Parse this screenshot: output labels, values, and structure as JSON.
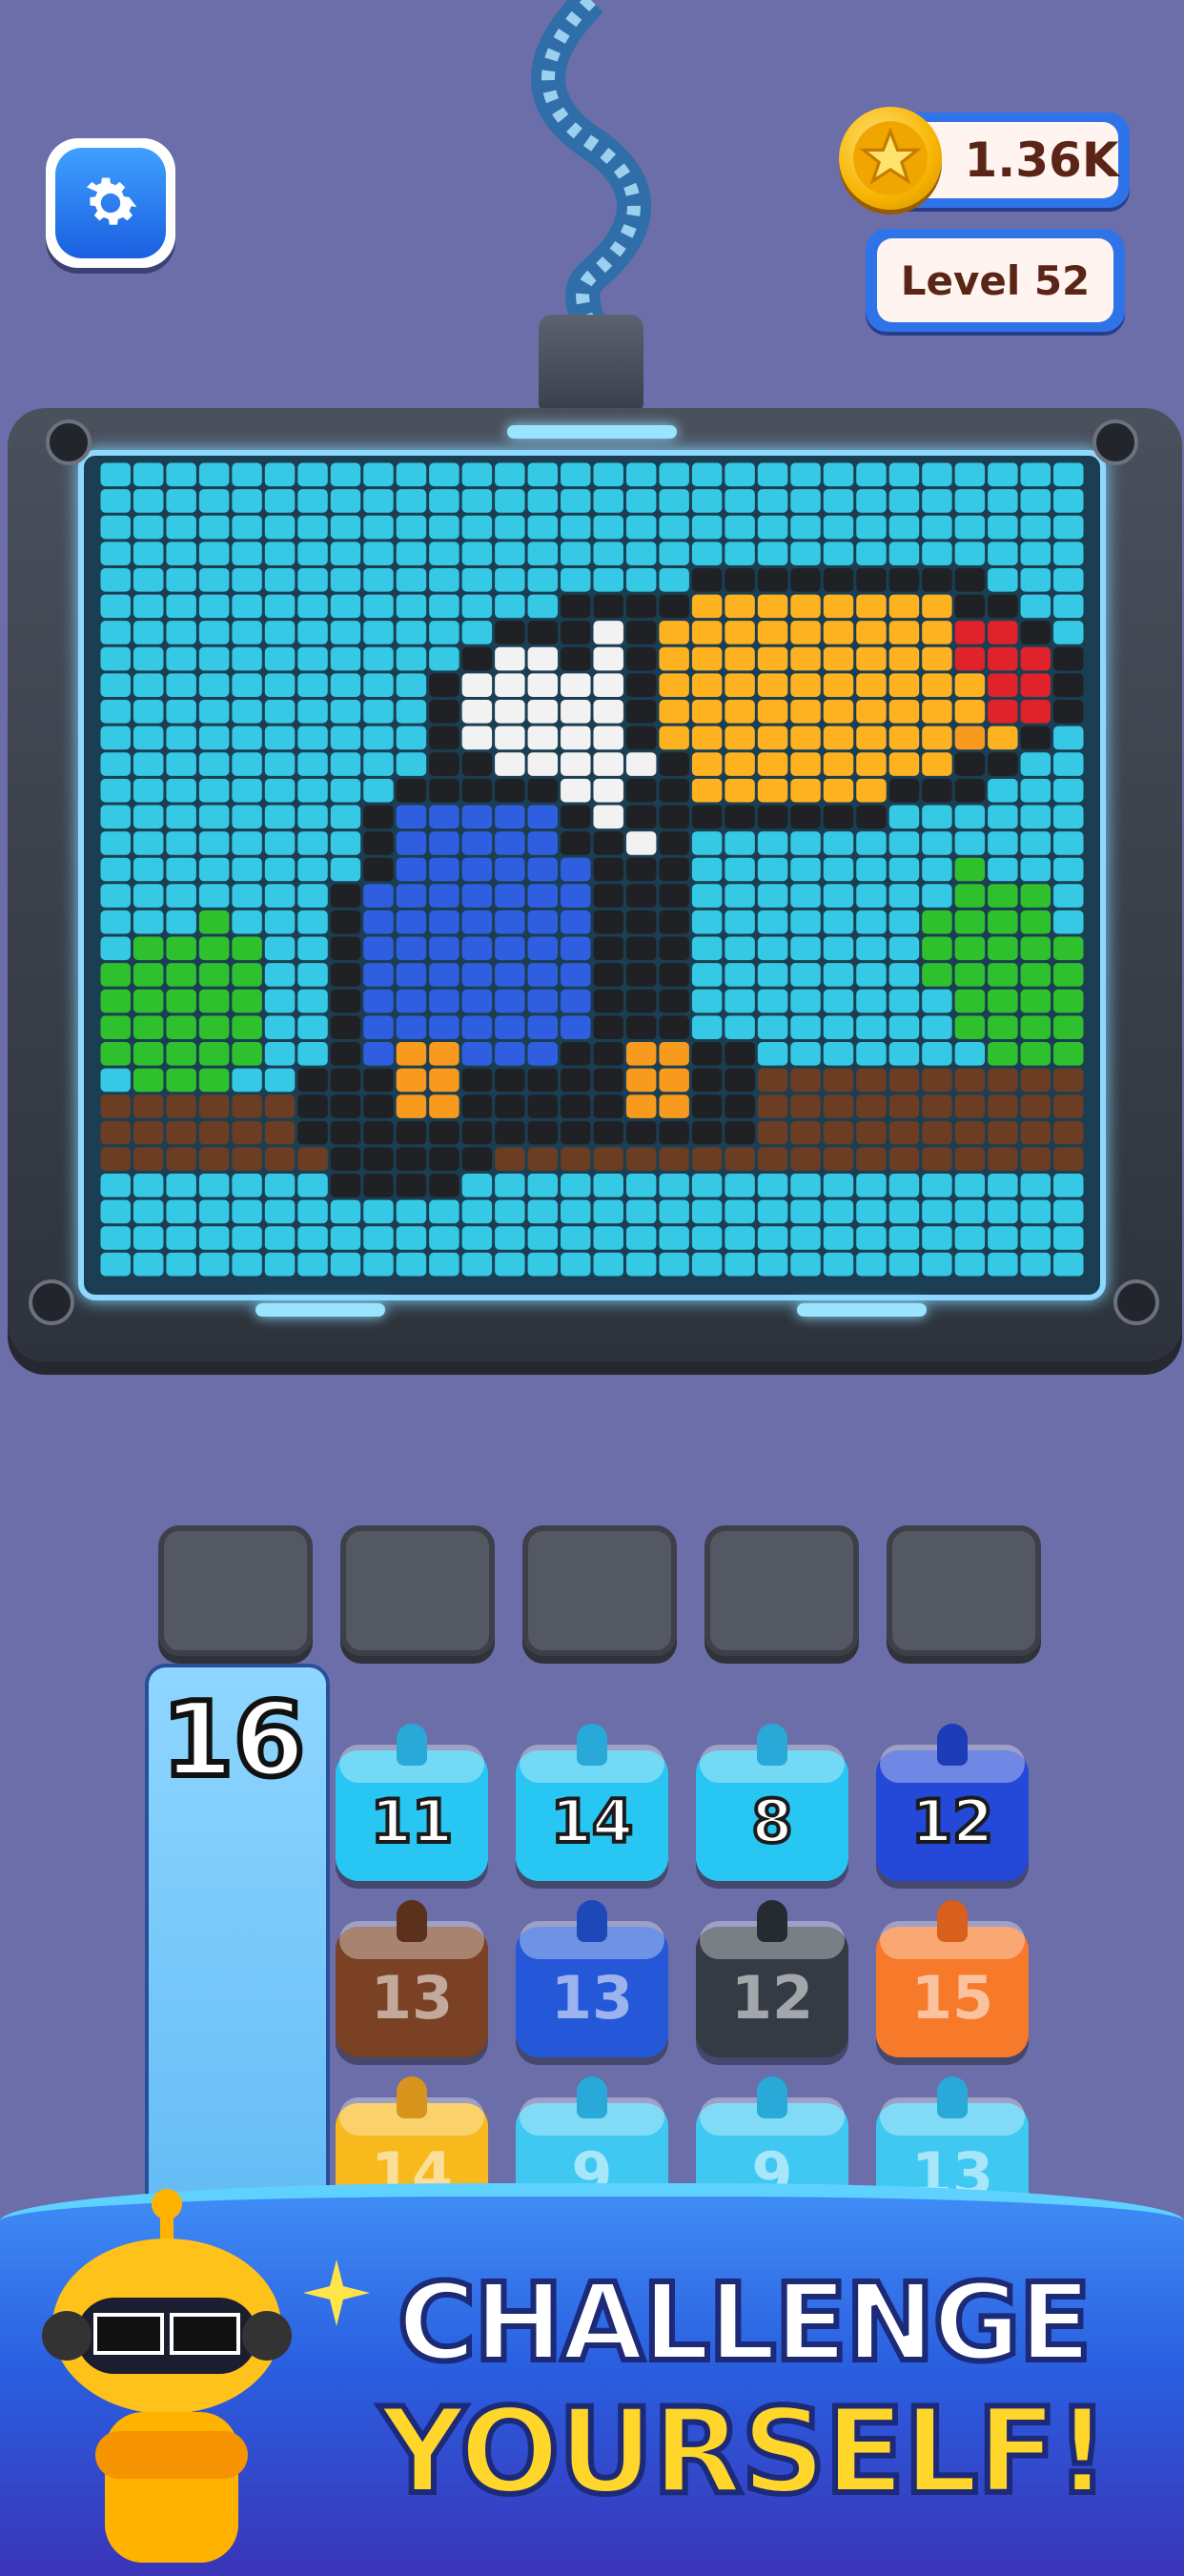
{
  "hud": {
    "coins": "1.36K",
    "level": "Level 52"
  },
  "queue_count": "16",
  "pixel_art": {
    "palette": {
      ".": "#35c9e6",
      "K": "#1f2125",
      "W": "#f2f2f2",
      "B": "#2f5fe0",
      "O": "#f79a1d",
      "Y": "#ffb21f",
      "R": "#e0222b",
      "G": "#2fc12d",
      "N": "#6b3d22"
    },
    "rows": [
      "..............................",
      "..............................",
      "..............................",
      "..........................,...",
      "..................KKKKKKKKK....",
      "..............KKKKYYYYYYYYKK...",
      "............KKKWKYYYYYYYYYRRK..",
      "...........KWWKWKYYYYYYYYYRRRK.",
      "..........KWWWWWKYYYYYYYYYYRRK.",
      "..........KWWWWWKYYYYYYYYYYRRK.",
      "..........KWWWWWKYYYYYYYYYOYK..",
      "..........KKWWWWWKYYYYYYYYKK...",
      ".........KKKKKWWKKYYYYYYKKK....",
      "........KBBBBBKWKKKKKKKK.......",
      "........KBBBBBKKWK.............",
      "........KBBBBBBKKK........G....",
      ".......KBBBBBBBKKK........GGG..",
      "...G...KBBBBBBBKKK.......GGGG.N",
      ".GGGG..KBBBBBBBKKK.......GGGGGG",
      "GGGGG..KBBBBBBBKKK.......GGGGGG",
      "GGGGG..KBBBBBBBKKK........GGGGG",
      "GGGGG..KBBBBBBBKKK........GGGGG",
      "GGGGG..KBOOBBBKKOOKK.......GGG.",
      ".GGG..KKKOOKKKKKOOKKNNNNNNNNNNN",
      "NNNNNNKKKOOKKKKKOOKKNNNNNNNNNNN",
      "NNNNNNKKKKKKKKKKKKKKNNNNNNNNNNN",
      "NNNNNNNKKKKKNNNNNNNNNNNNNNNNNNN",
      ".......KKKK....................",
      "..............................",
      "..............................",
      ".............................."
    ]
  },
  "slots_count": 5,
  "boxes": [
    [
      {
        "num": "11",
        "color": "#28c6f2",
        "lock": "#28a9d8",
        "faded": false
      },
      {
        "num": "14",
        "color": "#28c6f2",
        "lock": "#28a9d8",
        "faded": false
      },
      {
        "num": "8",
        "color": "#28c6f2",
        "lock": "#28a9d8",
        "faded": false
      },
      {
        "num": "12",
        "color": "#2448d8",
        "lock": "#1c3cb8",
        "faded": false
      }
    ],
    [
      {
        "num": "13",
        "color": "#7a4124",
        "lock": "#5b311c",
        "faded": true
      },
      {
        "num": "13",
        "color": "#2458d8",
        "lock": "#1c48b8",
        "faded": true
      },
      {
        "num": "12",
        "color": "#343b44",
        "lock": "#262b31",
        "faded": true
      },
      {
        "num": "15",
        "color": "#f7792a",
        "lock": "#d85f1c",
        "faded": true
      }
    ],
    [
      {
        "num": "14",
        "color": "#f7b91c",
        "lock": "#d8941c",
        "faded": true
      },
      {
        "num": "9",
        "color": "#3fc8f2",
        "lock": "#28a9d8",
        "faded": true
      },
      {
        "num": "9",
        "color": "#3fc8f2",
        "lock": "#28a9d8",
        "faded": true
      },
      {
        "num": "13",
        "color": "#3fc8f2",
        "lock": "#28a9d8",
        "faded": true
      }
    ]
  ],
  "banner": {
    "line1": "CHALLENGE",
    "line2": "YOURSELF!"
  }
}
